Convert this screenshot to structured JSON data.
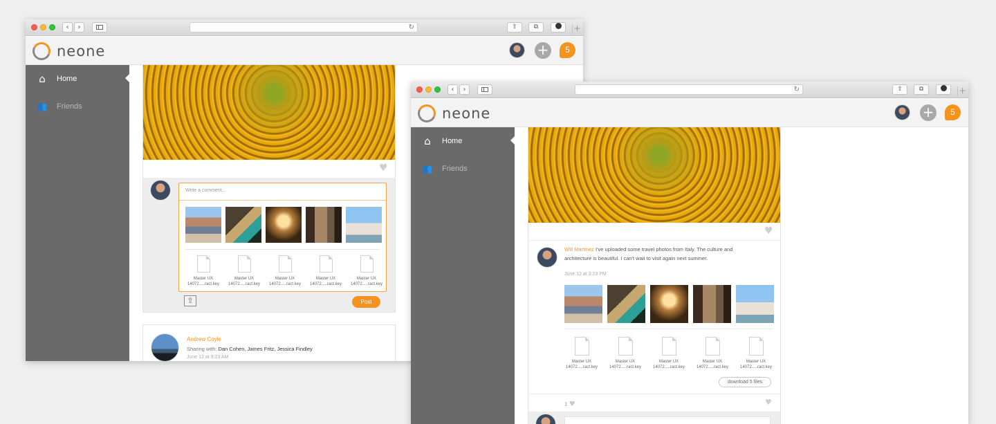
{
  "app": {
    "logo_text": "neone",
    "notifications_count": "5",
    "add_symbol": "+"
  },
  "colors": {
    "accent": "#f6921e",
    "sidebar": "#6a6a6a",
    "background": "#efefef"
  },
  "browser": {
    "back_glyph": "‹",
    "forward_glyph": "›",
    "reload_glyph": "↻",
    "new_tab_glyph": "+"
  },
  "sidebar": {
    "items": [
      {
        "label": "Home",
        "icon": "home-icon",
        "glyph": "⌂",
        "active": true
      },
      {
        "label": "Friends",
        "icon": "friends-icon",
        "glyph": "👥",
        "active": false
      }
    ]
  },
  "window1": {
    "heart_glyph": "♥",
    "comment_box": {
      "placeholder": "Write a comment...",
      "attachments_images": [
        "venice-1",
        "venice-2",
        "venice-3",
        "venice-4",
        "venice-5"
      ],
      "files": [
        {
          "line1": "Master UX",
          "line2": "14072.....ract.key"
        },
        {
          "line1": "Master UX",
          "line2": "14072.....ract.key"
        },
        {
          "line1": "Master UX",
          "line2": "14072.....ract.key"
        },
        {
          "line1": "Master UX",
          "line2": "14072.....ract.key"
        },
        {
          "line1": "Master UX",
          "line2": "14072.....ract.key"
        }
      ],
      "post_label": "Post"
    },
    "next_post": {
      "author": "Andrew Coyle",
      "sharing_prefix": "Sharing with: ",
      "sharing_with": "Dan Cohen, James Fritz, Jessica Findley",
      "timestamp": "June 12 at 9:23 AM"
    }
  },
  "window2": {
    "heart_glyph": "♥",
    "post": {
      "author": "Will Martinez",
      "text_line1": "I've uploaded some travel photos from Italy. The culture and",
      "text_line2": "architecture is beautiful. I can't wait to visit again next summer.",
      "timestamp": "June 12 at 3:23 PM",
      "images": [
        "venice-1",
        "venice-2",
        "venice-3",
        "venice-4",
        "venice-5"
      ],
      "files": [
        {
          "line1": "Master UX",
          "line2": "14072.....ract.key"
        },
        {
          "line1": "Master UX",
          "line2": "14072.....ract.key"
        },
        {
          "line1": "Master UX",
          "line2": "14072.....ract.key"
        },
        {
          "line1": "Master UX",
          "line2": "14072.....ract.key"
        },
        {
          "line1": "Master UX",
          "line2": "14072.....ract.key"
        }
      ],
      "download_label": "download 5 files",
      "like_count": "1"
    }
  }
}
